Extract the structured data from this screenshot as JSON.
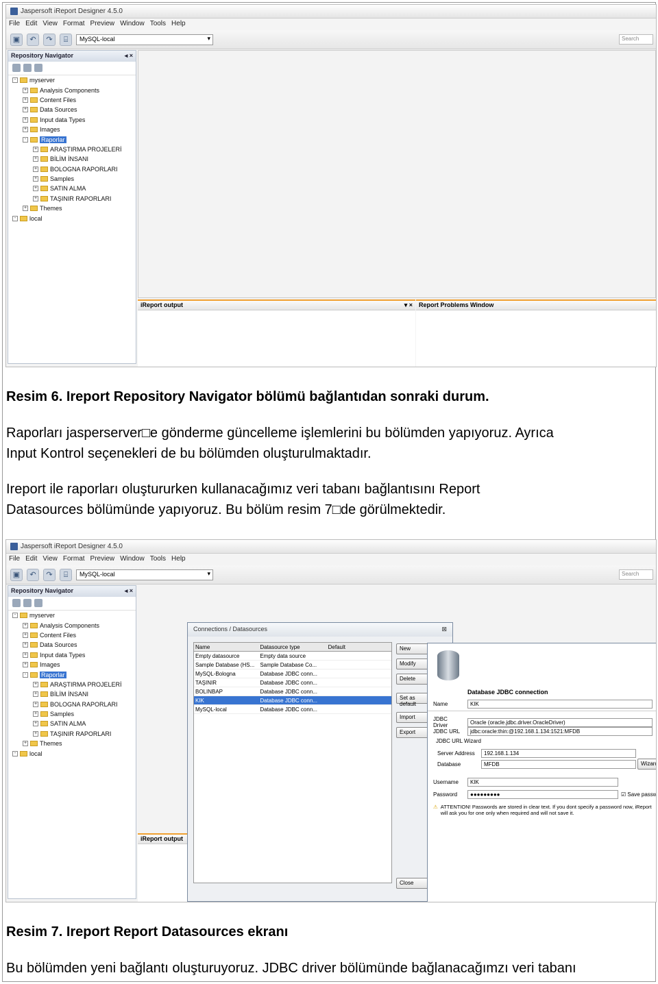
{
  "shot1": {
    "window_title": "Jaspersoft iReport Designer 4.5.0",
    "menu": [
      "File",
      "Edit",
      "View",
      "Format",
      "Preview",
      "Window",
      "Tools",
      "Help"
    ],
    "datasource": "MySQL-local",
    "search_placeholder": "Search",
    "navigator_title": "Repository Navigator",
    "tree": [
      {
        "label": "myserver",
        "indent": 1,
        "toggle": "-"
      },
      {
        "label": "Analysis Components",
        "indent": 2,
        "toggle": "+"
      },
      {
        "label": "Content Files",
        "indent": 2,
        "toggle": "+"
      },
      {
        "label": "Data Sources",
        "indent": 2,
        "toggle": "+"
      },
      {
        "label": "Input data Types",
        "indent": 2,
        "toggle": "+"
      },
      {
        "label": "Images",
        "indent": 2,
        "toggle": "+"
      },
      {
        "label": "Raporlar",
        "indent": 2,
        "toggle": "-",
        "selected": true
      },
      {
        "label": "ARAŞTIRMA PROJELERİ",
        "indent": 3,
        "toggle": "+"
      },
      {
        "label": "BİLİM İNSANI",
        "indent": 3,
        "toggle": "+"
      },
      {
        "label": "BOLOGNA RAPORLARI",
        "indent": 3,
        "toggle": "+"
      },
      {
        "label": "Samples",
        "indent": 3,
        "toggle": "+"
      },
      {
        "label": "SATIN ALMA",
        "indent": 3,
        "toggle": "+"
      },
      {
        "label": "TAŞINIR RAPORLARI",
        "indent": 3,
        "toggle": "+"
      },
      {
        "label": "Themes",
        "indent": 2,
        "toggle": "+"
      },
      {
        "label": "local",
        "indent": 1,
        "toggle": "-"
      }
    ],
    "output_title": "iReport output",
    "problems_title": "Report Problems Window"
  },
  "caption6": "Resim 6. Ireport Repository Navigator bölümü bağlantıdan sonraki durum.",
  "para1_line1": "Raporları jasperserver□e gönderme güncelleme işlemlerini bu bölümden yapıyoruz. Ayrıca",
  "para1_line2": "Input Kontrol seçenekleri de bu bölümden oluşturulmaktadır.",
  "para2_line1": "Ireport ile raporları oluştururken kullanacağımız veri tabanı bağlantısını Report",
  "para2_line2": "Datasources  bölümünde yapıyoruz. Bu bölüm resim 7□de görülmektedir.",
  "shot2": {
    "connections_title": "Connections / Datasources",
    "columns": [
      "Name",
      "Datasource type",
      "Default"
    ],
    "rows": [
      {
        "name": "Empty datasource",
        "type": "Empty data source",
        "default": false
      },
      {
        "name": "Sample Database (HS...",
        "type": "Sample Database Co...",
        "default": false
      },
      {
        "name": "MySQL-Bologna",
        "type": "Database JDBC conn...",
        "default": false
      },
      {
        "name": "TAŞINIR",
        "type": "Database JDBC conn...",
        "default": false
      },
      {
        "name": "BOLINBAP",
        "type": "Database JDBC conn...",
        "default": false
      },
      {
        "name": "KIK",
        "type": "Database JDBC conn...",
        "default": false,
        "selected": true
      },
      {
        "name": "MySQL-local",
        "type": "Database JDBC conn...",
        "default": true
      }
    ],
    "buttons": [
      "New",
      "Modify",
      "Delete",
      "Set as default",
      "Import",
      "Export"
    ],
    "close_label": "Close",
    "jdbc_title": "Database JDBC connection",
    "name_label": "Name",
    "name_value": "KIK",
    "driver_label": "JDBC Driver",
    "driver_value": "Oracle (oracle.jdbc.driver.OracleDriver)",
    "url_label": "JDBC URL",
    "url_value": "jdbc:oracle:thin:@192.168.1.134:1521:MFDB",
    "wizard_label": "JDBC URL Wizard",
    "server_label": "Server Address",
    "server_value": "192.168.1.134",
    "database_label": "Database",
    "database_value": "MFDB",
    "wizard_button": "Wizard",
    "username_label": "Username",
    "username_value": "KIK",
    "password_label": "Password",
    "password_value": "●●●●●●●●●",
    "save_password": "Save password",
    "attention": "ATTENTION! Passwords are stored in clear text. If you dont specify a password now, iReport will ask you for one only when required and will not save it."
  },
  "caption7": "Resim 7. Ireport Report Datasources ekranı",
  "para3": "Bu bölümden yeni bağlantı oluşturuyoruz. JDBC driver bölümünde bağlanacağımzı veri tabanı"
}
